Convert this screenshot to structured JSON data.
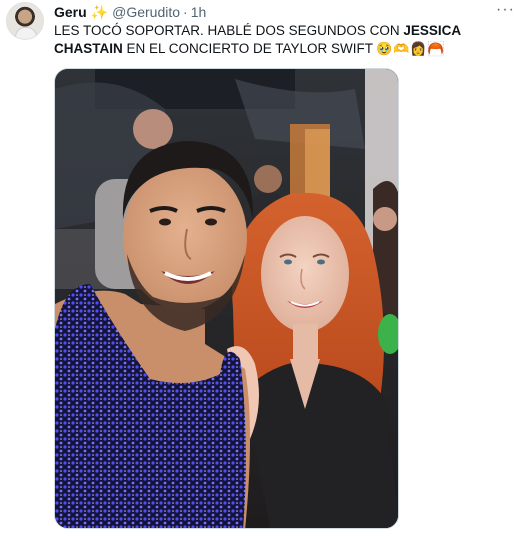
{
  "tweet": {
    "author": {
      "name": "Geru",
      "name_emoji": "✨",
      "handle": "@Gerudito",
      "separator": "·",
      "time": "1h"
    },
    "more_label": "···",
    "text": {
      "part1": "LES TOCÓ SOPORTAR. HABLÉ DOS SEGUNDOS CON ",
      "bold": "JESSICA CHASTAIN",
      "part2": " EN EL CONCIERTO DE TAYLOR SWIFT",
      "emojis": "🥹🫶👩🦰"
    }
  },
  "colors": {
    "text": "#0f1419",
    "secondary": "#536471",
    "border": "#cfd9de"
  },
  "icons": {
    "sparkle": "sparkle-icon",
    "more": "more-options-icon"
  }
}
